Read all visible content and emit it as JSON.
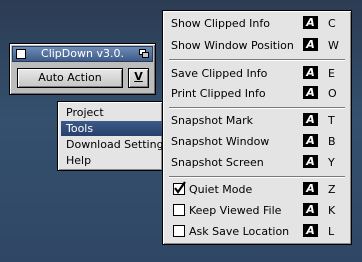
{
  "window": {
    "title": "ClipDown v3.0.",
    "action_label": "Auto Action",
    "dropdown_label": "V"
  },
  "context_menu": {
    "items": [
      {
        "label": "Project"
      },
      {
        "label": "Tools",
        "active": true
      },
      {
        "label": "Download Settings"
      },
      {
        "label": "Help"
      }
    ]
  },
  "tools_menu": {
    "amiga_key_glyph": "A",
    "groups": [
      [
        {
          "label": "Show Clipped Info",
          "key": "C"
        },
        {
          "label": "Show Window Position",
          "key": "W"
        }
      ],
      [
        {
          "label": "Save Clipped Info",
          "key": "E"
        },
        {
          "label": "Print Clipped Info",
          "key": "O"
        }
      ],
      [
        {
          "label": "Snapshot Mark",
          "key": "T"
        },
        {
          "label": "Snapshot Window",
          "key": "B"
        },
        {
          "label": "Snapshot Screen",
          "key": "Y"
        }
      ],
      [
        {
          "label": "Quiet Mode",
          "key": "Z",
          "checkbox": true,
          "checked": true
        },
        {
          "label": "Keep Viewed File",
          "key": "K",
          "checkbox": true,
          "checked": false
        },
        {
          "label": "Ask Save Location",
          "key": "L",
          "checkbox": true,
          "checked": false
        }
      ]
    ]
  },
  "colors": {
    "desktop": "#34506e",
    "menu_bg": "#e4e4e4",
    "highlight": "#24406a"
  }
}
